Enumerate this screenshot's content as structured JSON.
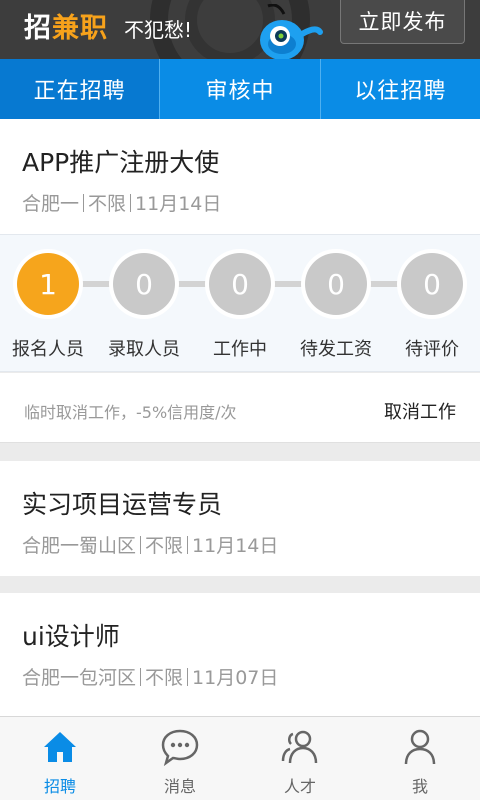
{
  "banner": {
    "brand_prefix": "招",
    "brand_accent": "兼职",
    "slogan": "不犯愁!",
    "publish_label": "立即发布"
  },
  "tabs": [
    {
      "label": "正在招聘",
      "active": true
    },
    {
      "label": "审核中",
      "active": false
    },
    {
      "label": "以往招聘",
      "active": false
    }
  ],
  "jobs": [
    {
      "title": "APP推广注册大使",
      "location": "合肥一",
      "requirement": "不限",
      "date": "11月14日",
      "steps": [
        {
          "count": "1",
          "label": "报名人员"
        },
        {
          "count": "0",
          "label": "录取人员"
        },
        {
          "count": "0",
          "label": "工作中"
        },
        {
          "count": "0",
          "label": "待发工资"
        },
        {
          "count": "0",
          "label": "待评价"
        }
      ],
      "cancel_note": "临时取消工作，-5%信用度/次",
      "cancel_label": "取消工作"
    },
    {
      "title": "实习项目运营专员",
      "location": "合肥一蜀山区",
      "requirement": "不限",
      "date": "11月14日"
    },
    {
      "title": "ui设计师",
      "location": "合肥一包河区",
      "requirement": "不限",
      "date": "11月07日"
    }
  ],
  "bottom_nav": [
    {
      "label": "招聘",
      "icon": "home-icon",
      "active": true
    },
    {
      "label": "消息",
      "icon": "chat-icon",
      "active": false
    },
    {
      "label": "人才",
      "icon": "people-icon",
      "active": false
    },
    {
      "label": "我",
      "icon": "person-icon",
      "active": false
    }
  ],
  "colors": {
    "primary": "#0a8ce6",
    "accent": "#f6a51c",
    "banner_bg": "#3d3d3d"
  }
}
